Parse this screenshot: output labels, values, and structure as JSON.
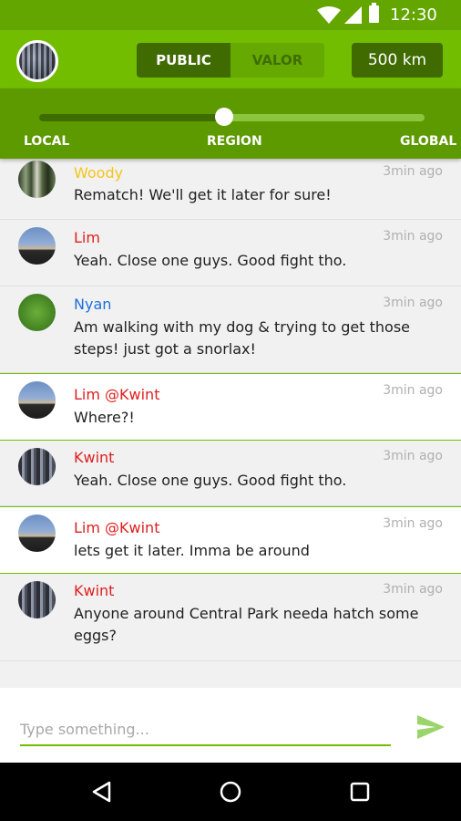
{
  "status_bar": {
    "time": "12:30"
  },
  "header": {
    "channels": [
      {
        "label": "PUBLIC",
        "active": true
      },
      {
        "label": "VALOR",
        "active": false
      }
    ],
    "distance": "500 km"
  },
  "range": {
    "labels": {
      "local": "LOCAL",
      "region": "REGION",
      "global": "GLOBAL"
    },
    "value_fraction": 0.48
  },
  "messages": [
    {
      "name": "Woody",
      "name_color": "#f5c518",
      "time": "3min ago",
      "text": "Rematch! We'll get it later for sure!",
      "avatar": "forest-photo",
      "mention": false
    },
    {
      "name": "Lim",
      "name_color": "#e01e1e",
      "time": "3min ago",
      "text": "Yeah. Close one guys. Good fight tho.",
      "avatar": "sunset-photo",
      "mention": false
    },
    {
      "name": "Nyan",
      "name_color": "#1e6fd9",
      "time": "3min ago",
      "text": "Am walking with my dog & trying to get those steps!  just got a snorlax!",
      "avatar": "grass-photo",
      "mention": false
    },
    {
      "name": "Lim @Kwint",
      "name_color": "#e01e1e",
      "time": "3min ago",
      "text": "Where?!",
      "avatar": "sunset-photo",
      "mention": true
    },
    {
      "name": "Kwint",
      "name_color": "#e01e1e",
      "time": "3min ago",
      "text": "Yeah. Close one guys. Good fight tho.",
      "avatar": "city-photo",
      "mention": false
    },
    {
      "name": "Lim @Kwint",
      "name_color": "#e01e1e",
      "time": "3min ago",
      "text": "lets get it later. Imma be around",
      "avatar": "sunset-photo",
      "mention": true
    },
    {
      "name": "Kwint",
      "name_color": "#e01e1e",
      "time": "3min ago",
      "text": "Anyone around Central Park needa hatch some eggs?",
      "avatar": "city-photo",
      "mention": false
    }
  ],
  "composer": {
    "placeholder": "Type something..."
  },
  "colors": {
    "primary_green": "#72bd00",
    "dark_green": "#3f6b00",
    "status_green": "#64a600",
    "send_icon": "#9bd46a"
  }
}
